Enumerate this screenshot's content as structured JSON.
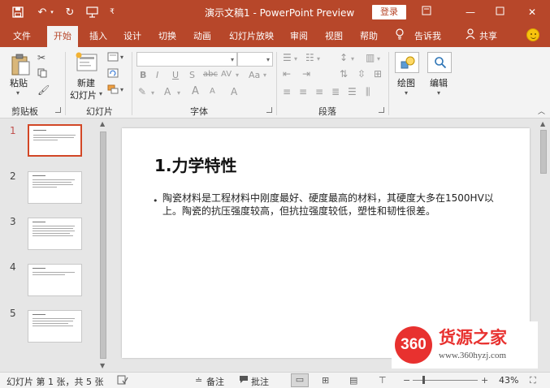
{
  "window": {
    "title": "演示文稿1 - PowerPoint Preview",
    "login_label": "登录"
  },
  "menu": {
    "items": [
      "文件",
      "开始",
      "插入",
      "设计",
      "切换",
      "动画",
      "幻灯片放映",
      "审阅",
      "视图",
      "帮助"
    ],
    "active_index": 1,
    "tell_me": "告诉我",
    "share": "共享"
  },
  "ribbon": {
    "paste": "粘贴",
    "new_slide_line1": "新建",
    "new_slide_line2": "幻灯片",
    "draw": "绘图",
    "edit": "编辑",
    "groups": {
      "clipboard": "剪贴板",
      "slides": "幻灯片",
      "font": "字体",
      "paragraph": "段落"
    },
    "font_buttons": {
      "bold": "B",
      "italic": "I",
      "underline": "U",
      "shadow": "S",
      "strike": "abc",
      "spacing": "AV",
      "grow": "A",
      "shrink": "A",
      "clear": "A",
      "case": "Aa",
      "color": "A"
    }
  },
  "slides": {
    "numbers": [
      "1",
      "2",
      "3",
      "4",
      "5"
    ],
    "active_index": 0
  },
  "slide": {
    "title": "1.力学特性",
    "body": "陶瓷材料是工程材料中刚度最好、硬度最高的材料，其硬度大多在1500HV以上。陶瓷的抗压强度较高，但抗拉强度较低，塑性和韧性很差。"
  },
  "status": {
    "slide_info": "幻灯片 第 1 张，共 5 张",
    "notes": "备注",
    "comments": "批注",
    "zoom": "43%"
  },
  "watermark": {
    "badge": "360",
    "name": "货源之家",
    "url": "www.360hyzj.com"
  },
  "colors": {
    "accent": "#b7472a",
    "active_thumb": "#d24726",
    "watermark_red": "#e8312f"
  }
}
